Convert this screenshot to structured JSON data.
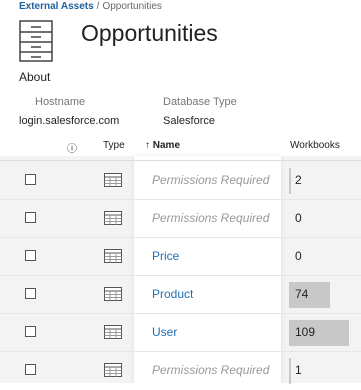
{
  "breadcrumb": {
    "parent": "External Assets",
    "separator": "/",
    "current": "Opportunities"
  },
  "title": "Opportunities",
  "about": {
    "heading": "About",
    "hostname_label": "Hostname",
    "hostname_value": "login.salesforce.com",
    "dbtype_label": "Database Type",
    "dbtype_value": "Salesforce"
  },
  "table": {
    "headers": {
      "info": "ⓘ",
      "type": "Type",
      "name": "↑ Name",
      "workbooks": "Workbooks"
    },
    "rows": [
      {
        "name": "Permissions Required",
        "restricted": true,
        "workbooks": "2",
        "workbooks_value": 2
      },
      {
        "name": "Permissions Required",
        "restricted": true,
        "workbooks": "0",
        "workbooks_value": 0
      },
      {
        "name": "Price",
        "restricted": false,
        "workbooks": "0",
        "workbooks_value": 0
      },
      {
        "name": "Product",
        "restricted": false,
        "workbooks": "74",
        "workbooks_value": 74
      },
      {
        "name": "User",
        "restricted": false,
        "workbooks": "109",
        "workbooks_value": 109
      },
      {
        "name": "Permissions Required",
        "restricted": true,
        "workbooks": "1",
        "workbooks_value": 1
      }
    ],
    "workbooks_max": 109
  },
  "colors": {
    "link": "#1f6fb5",
    "restricted": "#999999",
    "bar": "#c8c8c8"
  }
}
